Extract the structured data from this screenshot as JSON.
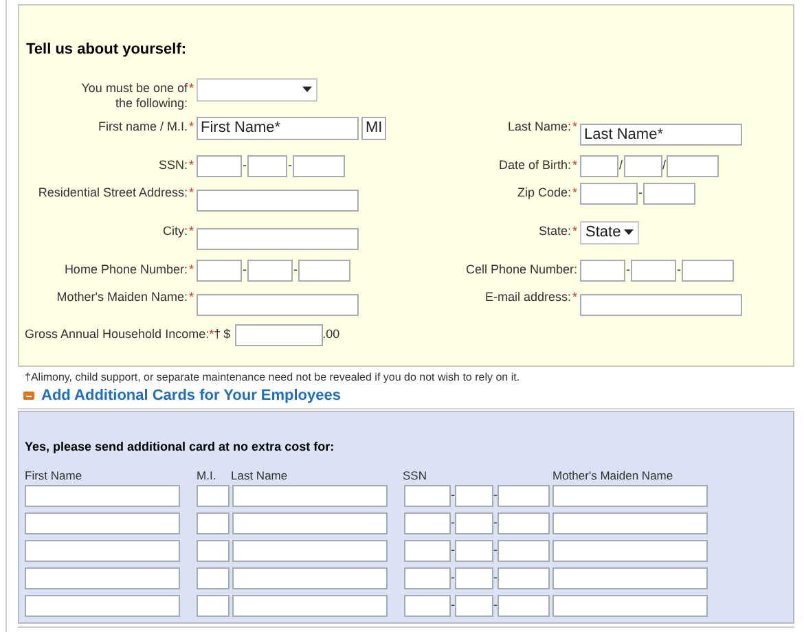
{
  "about": {
    "title": "Tell us about yourself:",
    "rows": [
      {
        "left": {
          "kind": "select",
          "label": "You must be one of the following:",
          "marker": "*"
        }
      },
      {
        "left": {
          "kind": "name",
          "label": "First name / M.I.",
          "marker": "*",
          "placeholders": [
            "First Name*",
            "MI"
          ]
        },
        "right": {
          "kind": "text",
          "label": "Last Name:",
          "marker": "*",
          "placeholder": "Last Name*"
        }
      },
      {
        "left": {
          "kind": "ssn",
          "label": "SSN:",
          "marker": "*",
          "separator": "-"
        },
        "right": {
          "kind": "date",
          "label": "Date of Birth:",
          "marker": "*",
          "separator": "/"
        }
      },
      {
        "left": {
          "kind": "text",
          "label": "Residential Street Address:",
          "marker": "*"
        },
        "right": {
          "kind": "zip",
          "label": "Zip Code:",
          "marker": "*",
          "separator": "-"
        }
      },
      {
        "left": {
          "kind": "text",
          "label": "City:",
          "marker": "*"
        },
        "right": {
          "kind": "select",
          "label": "State:",
          "marker": "*",
          "value": "State"
        }
      },
      {
        "left": {
          "kind": "phone",
          "label": "Home Phone Number:",
          "marker": "*",
          "separator": "-"
        },
        "right": {
          "kind": "phone",
          "label": "Cell Phone Number:",
          "separator": "-"
        }
      },
      {
        "left": {
          "kind": "text",
          "label": "Mother's Maiden Name:",
          "marker": "*"
        },
        "right": {
          "kind": "text",
          "label": "E-mail address:",
          "marker": "*"
        }
      }
    ],
    "income": {
      "label": "Gross Annual Household Income:",
      "marker": "*",
      "mark": "†",
      "prefix": "$",
      "suffix": ".00"
    },
    "footnote": "†Alimony, child support, or separate maintenance need not be revealed if you do not wish to rely on it."
  },
  "employees": {
    "title": "Add Additional Cards for Your Employees",
    "expanded": true,
    "prompt": "Yes, please send additional card at no extra cost for:",
    "columns": [
      "First Name",
      "M.I.",
      "Last Name",
      "SSN",
      "Mother's Maiden Name"
    ],
    "ssn_separator": "-",
    "rows": [
      {
        "kind": "blank"
      },
      {
        "kind": "blank"
      },
      {
        "kind": "blank"
      },
      {
        "kind": "blank"
      },
      {
        "kind": "blank"
      }
    ]
  }
}
